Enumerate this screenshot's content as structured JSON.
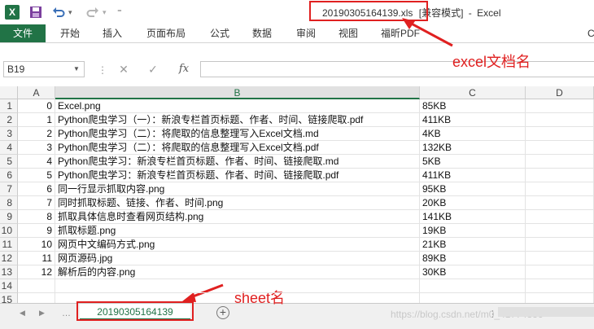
{
  "window": {
    "app_icon_letter": "X",
    "filename": "20190305164139.xls",
    "mode": "[兼容模式]",
    "separator": "-",
    "app_name": "Excel"
  },
  "qat": {
    "save_icon": "save-icon",
    "undo_icon": "undo-icon",
    "redo_icon": "redo-icon",
    "customize_icon": "customize-icon"
  },
  "ribbon": {
    "file": "文件",
    "tabs": [
      "开始",
      "插入",
      "页面布局",
      "公式",
      "数据",
      "审阅",
      "视图",
      "福昕PDF",
      "C"
    ]
  },
  "formula_bar": {
    "name_box": "B19",
    "fx": "fx",
    "value": ""
  },
  "grid": {
    "columns": [
      "A",
      "B",
      "C",
      "D"
    ],
    "rows": [
      {
        "n": "1",
        "a": "0",
        "b": "Excel.png",
        "c": "85KB"
      },
      {
        "n": "2",
        "a": "1",
        "b": "Python爬虫学习（一）：新浪专栏首页标题、作者、时间、链接爬取.pdf",
        "c": "411KB"
      },
      {
        "n": "3",
        "a": "2",
        "b": "Python爬虫学习（二）：将爬取的信息整理写入Excel文档.md",
        "c": "4KB"
      },
      {
        "n": "4",
        "a": "3",
        "b": "Python爬虫学习（二）：将爬取的信息整理写入Excel文档.pdf",
        "c": "132KB"
      },
      {
        "n": "5",
        "a": "4",
        "b": "Python爬虫学习：新浪专栏首页标题、作者、时间、链接爬取.md",
        "c": "5KB"
      },
      {
        "n": "6",
        "a": "5",
        "b": "Python爬虫学习：新浪专栏首页标题、作者、时间、链接爬取.pdf",
        "c": "411KB"
      },
      {
        "n": "7",
        "a": "6",
        "b": "同一行显示抓取内容.png",
        "c": "95KB"
      },
      {
        "n": "8",
        "a": "7",
        "b": "同时抓取标题、链接、作者、时间.png",
        "c": "20KB"
      },
      {
        "n": "9",
        "a": "8",
        "b": "抓取具体信息时查看网页结构.png",
        "c": "141KB"
      },
      {
        "n": "10",
        "a": "9",
        "b": "抓取标题.png",
        "c": "19KB"
      },
      {
        "n": "11",
        "a": "10",
        "b": "网页中文编码方式.png",
        "c": "21KB"
      },
      {
        "n": "12",
        "a": "11",
        "b": "网页源码.jpg",
        "c": "89KB"
      },
      {
        "n": "13",
        "a": "12",
        "b": "解析后的内容.png",
        "c": "30KB"
      },
      {
        "n": "14",
        "a": "",
        "b": "",
        "c": ""
      },
      {
        "n": "15",
        "a": "",
        "b": "",
        "c": ""
      }
    ]
  },
  "sheets": {
    "active": "20190305164139",
    "add_icon": "plus-circle-icon",
    "watermark": "https://blog.csdn.net/m0_41774836"
  },
  "annotations": {
    "filename_note": "excel文档名",
    "sheet_note": "sheet名"
  },
  "colors": {
    "excel_green": "#217346",
    "annotation_red": "#e02020"
  }
}
